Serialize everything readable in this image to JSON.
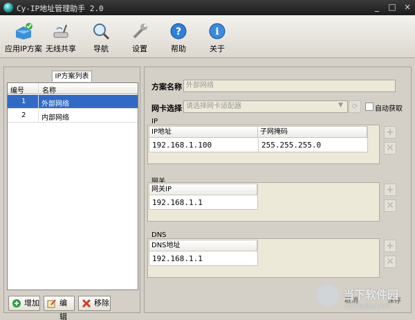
{
  "window": {
    "title": "Cy-IP地址管理助手 2.0"
  },
  "toolbar": {
    "items": [
      {
        "label": "应用IP方案",
        "icon": "apply-icon"
      },
      {
        "label": "无线共享",
        "icon": "wifi-router-icon"
      },
      {
        "label": "导航",
        "icon": "magnifier-icon"
      },
      {
        "label": "设置",
        "icon": "wrench-icon"
      },
      {
        "label": "帮助",
        "icon": "help-icon"
      },
      {
        "label": "关于",
        "icon": "info-icon"
      }
    ]
  },
  "left_panel": {
    "tab_label": "IP方案列表",
    "columns": [
      "编号",
      "名称"
    ],
    "rows": [
      {
        "id": "1",
        "name": "外部网络",
        "selected": true
      },
      {
        "id": "2",
        "name": "内部网络",
        "selected": false
      }
    ],
    "buttons": {
      "add": "增加",
      "edit": "编辑",
      "remove": "移除"
    }
  },
  "right_panel": {
    "scheme_name_label": "方案名称",
    "scheme_name_value": "外部网络",
    "nic_label": "网卡选择",
    "nic_placeholder": "请选择网卡适配器",
    "auto_label": "自动获取",
    "ip_group": {
      "title": "IP",
      "col1": "IP地址",
      "col2": "子网掩码",
      "ip": "192.168.1.100",
      "mask": "255.255.255.0"
    },
    "gateway_group": {
      "title": "网关",
      "col1": "网关IP",
      "value": "192.168.1.1"
    },
    "dns_group": {
      "title": "DNS",
      "col1": "DNS地址",
      "value": "192.168.1.1"
    },
    "bottom": {
      "cancel": "取消",
      "save": "保存"
    }
  },
  "watermark": {
    "text": "当下软件园",
    "url": "downxia.com"
  },
  "colors": {
    "selection": "#316ac5",
    "titlebar": "#2a2a2a"
  }
}
